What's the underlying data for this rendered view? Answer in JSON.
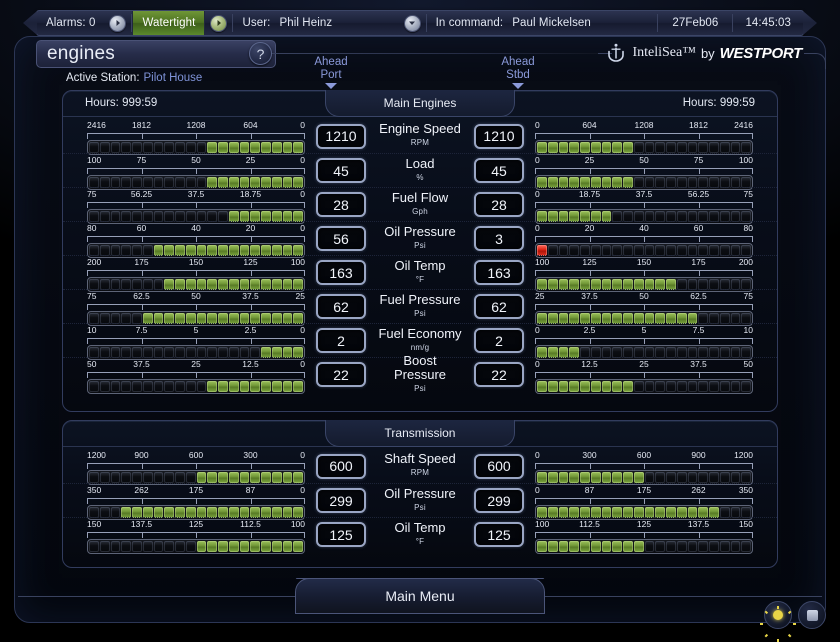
{
  "topbar": {
    "alarms_label": "Alarms: 0",
    "watertight_label": "Watertight",
    "user_label": "User:",
    "user_value": "Phil Heinz",
    "command_label": "In command:",
    "command_value": "Paul Mickelsen",
    "date": "27Feb06",
    "time": "14:45:03",
    "green_hex": "#4d7322"
  },
  "header": {
    "page_title": "engines",
    "help_label": "?",
    "active_station_label": "Active Station:",
    "active_station_value": "Pilot House",
    "logo_primary": "InteliSea™",
    "logo_by": "by",
    "logo_brand": "WESTPORT"
  },
  "throttles": [
    {
      "name": "ahead-port",
      "line1": "Ahead",
      "line2": "Port"
    },
    {
      "name": "ahead-stbd",
      "line1": "Ahead",
      "line2": "Stbd"
    }
  ],
  "panels": [
    {
      "id": "panel-main",
      "title": "Main Engines",
      "hours_port_label": "Hours: 999:59",
      "hours_stbd_label": "Hours: 999:59",
      "rows": [
        {
          "name": "Engine Speed",
          "unit": "RPM",
          "port_value": "1210",
          "stbd_value": "1210",
          "port_ticks": [
            "2416",
            "1812",
            "1208",
            "604",
            "0"
          ],
          "stbd_ticks": [
            "0",
            "604",
            "1208",
            "1812",
            "2416"
          ],
          "segments": 20,
          "port_on": 9,
          "stbd_on": 9,
          "port_alarm": false,
          "stbd_alarm": false
        },
        {
          "name": "Load",
          "unit": "%",
          "port_value": "45",
          "stbd_value": "45",
          "port_ticks": [
            "100",
            "75",
            "50",
            "25",
            "0"
          ],
          "stbd_ticks": [
            "0",
            "25",
            "50",
            "75",
            "100"
          ],
          "segments": 20,
          "port_on": 9,
          "stbd_on": 9,
          "port_alarm": false,
          "stbd_alarm": false
        },
        {
          "name": "Fuel Flow",
          "unit": "Gph",
          "port_value": "28",
          "stbd_value": "28",
          "port_ticks": [
            "75",
            "56.25",
            "37.5",
            "18.75",
            "0"
          ],
          "stbd_ticks": [
            "0",
            "18.75",
            "37.5",
            "56.25",
            "75"
          ],
          "segments": 20,
          "port_on": 7,
          "stbd_on": 7,
          "port_alarm": false,
          "stbd_alarm": false
        },
        {
          "name": "Oil Pressure",
          "unit": "Psi",
          "port_value": "56",
          "stbd_value": "3",
          "port_ticks": [
            "80",
            "60",
            "40",
            "20",
            "0"
          ],
          "stbd_ticks": [
            "0",
            "20",
            "40",
            "60",
            "80"
          ],
          "segments": 20,
          "port_on": 14,
          "stbd_on": 1,
          "port_alarm": false,
          "stbd_alarm": true
        },
        {
          "name": "Oil Temp",
          "unit": "°F",
          "port_value": "163",
          "stbd_value": "163",
          "port_ticks": [
            "200",
            "175",
            "150",
            "125",
            "100"
          ],
          "stbd_ticks": [
            "100",
            "125",
            "150",
            "175",
            "200"
          ],
          "segments": 20,
          "port_on": 13,
          "stbd_on": 13,
          "port_alarm": false,
          "stbd_alarm": false
        },
        {
          "name": "Fuel Pressure",
          "unit": "Psi",
          "port_value": "62",
          "stbd_value": "62",
          "port_ticks": [
            "75",
            "62.5",
            "50",
            "37.5",
            "25"
          ],
          "stbd_ticks": [
            "25",
            "37.5",
            "50",
            "62.5",
            "75"
          ],
          "segments": 20,
          "port_on": 15,
          "stbd_on": 15,
          "port_alarm": false,
          "stbd_alarm": false
        },
        {
          "name": "Fuel Economy",
          "unit": "nm/g",
          "port_value": "2",
          "stbd_value": "2",
          "port_ticks": [
            "10",
            "7.5",
            "5",
            "2.5",
            "0"
          ],
          "stbd_ticks": [
            "0",
            "2.5",
            "5",
            "7.5",
            "10"
          ],
          "segments": 20,
          "port_on": 4,
          "stbd_on": 4,
          "port_alarm": false,
          "stbd_alarm": false
        },
        {
          "name": "Boost Pressure",
          "unit": "Psi",
          "port_value": "22",
          "stbd_value": "22",
          "port_ticks": [
            "50",
            "37.5",
            "25",
            "12.5",
            "0"
          ],
          "stbd_ticks": [
            "0",
            "12.5",
            "25",
            "37.5",
            "50"
          ],
          "segments": 20,
          "port_on": 9,
          "stbd_on": 9,
          "port_alarm": false,
          "stbd_alarm": false
        }
      ]
    },
    {
      "id": "panel-trans",
      "title": "Transmission",
      "hours_port_label": "",
      "hours_stbd_label": "",
      "rows": [
        {
          "name": "Shaft Speed",
          "unit": "RPM",
          "port_value": "600",
          "stbd_value": "600",
          "port_ticks": [
            "1200",
            "900",
            "600",
            "300",
            "0"
          ],
          "stbd_ticks": [
            "0",
            "300",
            "600",
            "900",
            "1200"
          ],
          "segments": 20,
          "port_on": 10,
          "stbd_on": 10,
          "port_alarm": false,
          "stbd_alarm": false
        },
        {
          "name": "Oil Pressure",
          "unit": "Psi",
          "port_value": "299",
          "stbd_value": "299",
          "port_ticks": [
            "350",
            "262",
            "175",
            "87",
            "0"
          ],
          "stbd_ticks": [
            "0",
            "87",
            "175",
            "262",
            "350"
          ],
          "segments": 20,
          "port_on": 17,
          "stbd_on": 17,
          "port_alarm": false,
          "stbd_alarm": false
        },
        {
          "name": "Oil Temp",
          "unit": "°F",
          "port_value": "125",
          "stbd_value": "125",
          "port_ticks": [
            "150",
            "137.5",
            "125",
            "112.5",
            "100"
          ],
          "stbd_ticks": [
            "100",
            "112.5",
            "125",
            "137.5",
            "150"
          ],
          "segments": 20,
          "port_on": 10,
          "stbd_on": 10,
          "port_alarm": false,
          "stbd_alarm": false
        }
      ]
    }
  ],
  "footer": {
    "main_menu_label": "Main Menu",
    "brightness_icon": "sun-icon",
    "stop_icon": "square-icon"
  }
}
